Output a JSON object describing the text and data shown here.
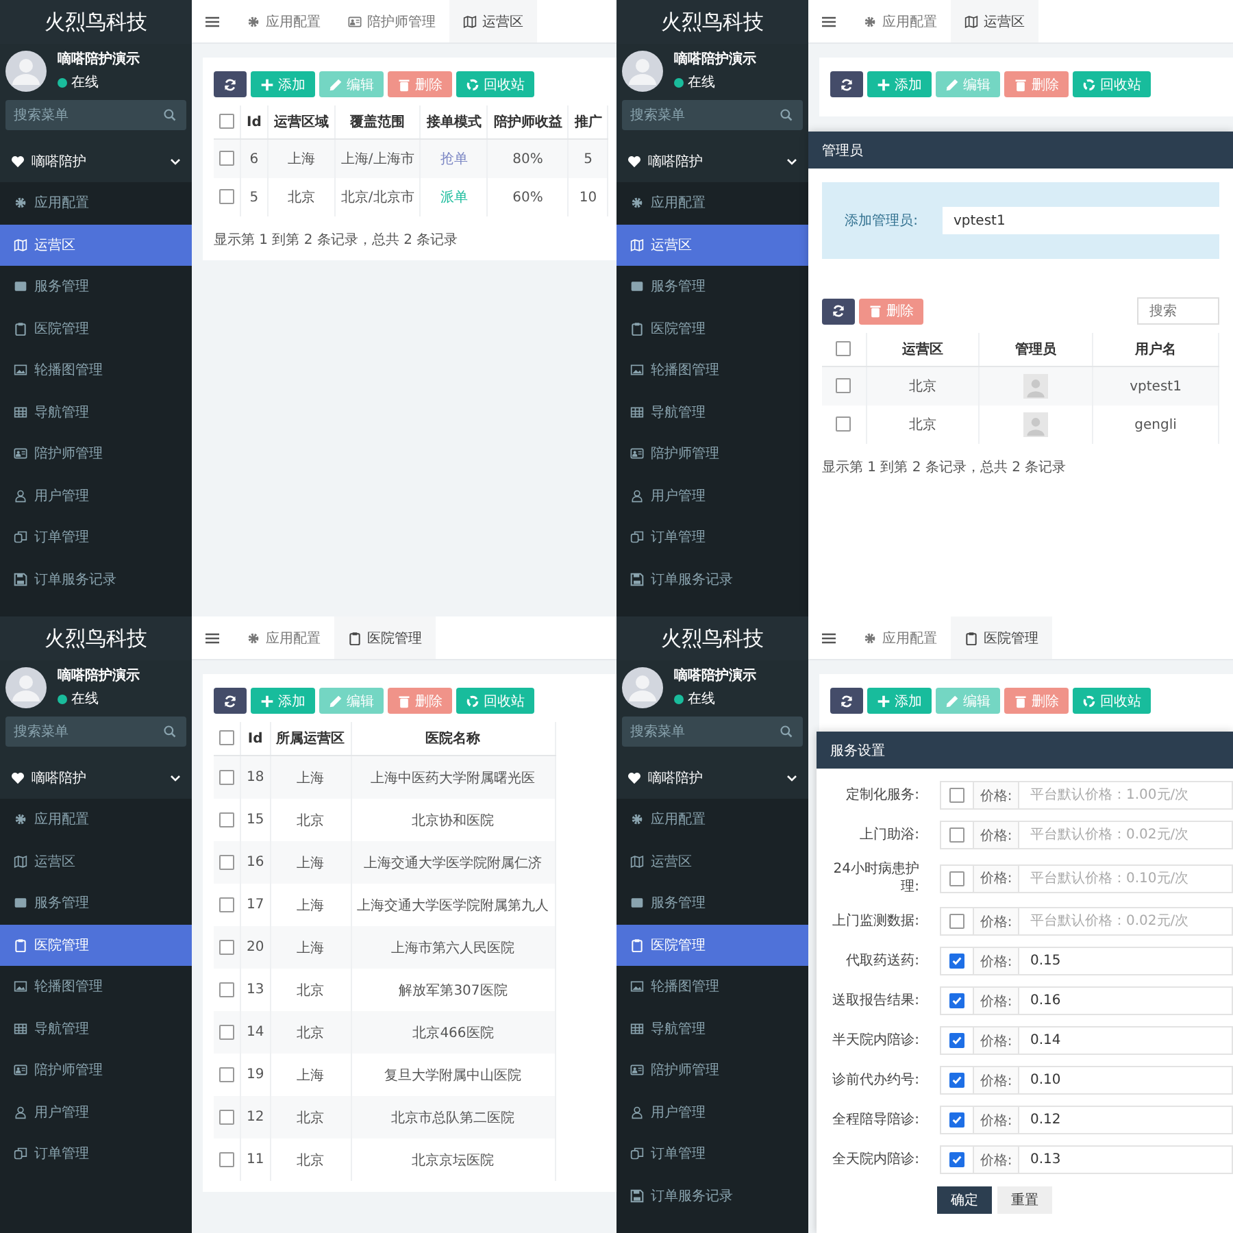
{
  "panels": [
    {
      "sidebar": {
        "brand": "火烈鸟科技",
        "user": {
          "name": "嘀嗒陪护演示",
          "status": "在线"
        },
        "search": {
          "placeholder": "搜索菜单"
        },
        "group": {
          "label": "嘀嗒陪护",
          "expanded": true
        },
        "items": [
          {
            "kind": "settings",
            "label": "应用配置",
            "selected": false
          },
          {
            "kind": "map",
            "label": "运营区",
            "selected": true
          },
          {
            "kind": "window",
            "label": "服务管理",
            "selected": false
          },
          {
            "kind": "clipboard",
            "label": "医院管理",
            "selected": false
          },
          {
            "kind": "image",
            "label": "轮播图管理",
            "selected": false
          },
          {
            "kind": "grid",
            "label": "导航管理",
            "selected": false
          },
          {
            "kind": "idcard",
            "label": "陪护师管理",
            "selected": false
          },
          {
            "kind": "user",
            "label": "用户管理",
            "selected": false
          },
          {
            "kind": "copy",
            "label": "订单管理",
            "selected": false
          },
          {
            "kind": "save",
            "label": "订单服务记录",
            "selected": false
          }
        ]
      },
      "tabs": [
        {
          "kind": "settings",
          "label": "应用配置",
          "selected": false
        },
        {
          "kind": "idcard",
          "label": "陪护师管理",
          "selected": false
        },
        {
          "kind": "map",
          "label": "运营区",
          "selected": true
        }
      ],
      "content": {
        "kind": "table",
        "toolbar": [
          {
            "kind": "refresh",
            "disabled": false
          },
          {
            "kind": "add",
            "label": "添加",
            "disabled": false
          },
          {
            "kind": "edit",
            "label": "编辑",
            "disabled": true
          },
          {
            "kind": "delete",
            "label": "删除",
            "disabled": true
          },
          {
            "kind": "recycle",
            "label": "回收站",
            "disabled": false
          }
        ],
        "table": {
          "all_checked": false,
          "columns": [
            "Id",
            "运营区域",
            "覆盖范围",
            "接单模式",
            "陪护师收益",
            "推广"
          ],
          "rows": [
            {
              "checked": false,
              "cells": [
                "6",
                "上海",
                "上海/上海市",
                {
                  "text": "抢单",
                  "color": "#7b86c4"
                },
                "80%",
                "5"
              ]
            },
            {
              "checked": false,
              "cells": [
                "5",
                "北京",
                "北京/北京市",
                {
                  "text": "派单",
                  "color": "#1abc9c"
                },
                "60%",
                "10"
              ]
            }
          ]
        },
        "footer": "显示第 1 到第 2 条记录，总共 2 条记录"
      }
    },
    {
      "sidebar": {
        "brand": "火烈鸟科技",
        "user": {
          "name": "嘀嗒陪护演示",
          "status": "在线"
        },
        "search": {
          "placeholder": "搜索菜单"
        },
        "group": {
          "label": "嘀嗒陪护",
          "expanded": true
        },
        "items": [
          {
            "kind": "settings",
            "label": "应用配置",
            "selected": false
          },
          {
            "kind": "map",
            "label": "运营区",
            "selected": true
          },
          {
            "kind": "window",
            "label": "服务管理",
            "selected": false
          },
          {
            "kind": "clipboard",
            "label": "医院管理",
            "selected": false
          },
          {
            "kind": "image",
            "label": "轮播图管理",
            "selected": false
          },
          {
            "kind": "grid",
            "label": "导航管理",
            "selected": false
          },
          {
            "kind": "idcard",
            "label": "陪护师管理",
            "selected": false
          },
          {
            "kind": "user",
            "label": "用户管理",
            "selected": false
          },
          {
            "kind": "copy",
            "label": "订单管理",
            "selected": false
          },
          {
            "kind": "save",
            "label": "订单服务记录",
            "selected": false
          }
        ]
      },
      "tabs": [
        {
          "kind": "settings",
          "label": "应用配置",
          "selected": false
        },
        {
          "kind": "map",
          "label": "运营区",
          "selected": true
        }
      ],
      "content": {
        "kind": "admin_modal",
        "toolbar": [
          {
            "kind": "refresh",
            "disabled": false
          },
          {
            "kind": "add",
            "label": "添加",
            "disabled": false
          },
          {
            "kind": "edit",
            "label": "编辑",
            "disabled": true
          },
          {
            "kind": "delete",
            "label": "删除",
            "disabled": true
          },
          {
            "kind": "recycle",
            "label": "回收站",
            "disabled": false
          }
        ],
        "modal": {
          "title": "管理员",
          "form": {
            "label": "添加管理员:",
            "value": "vptest1"
          },
          "toolbar": [
            {
              "kind": "refresh",
              "disabled": false
            },
            {
              "kind": "delete",
              "label": "删除",
              "disabled": true
            }
          ],
          "search": {
            "placeholder": "搜索"
          },
          "table": {
            "all_checked": false,
            "columns": [
              "运营区",
              "管理员",
              "用户名"
            ],
            "rows": [
              {
                "checked": false,
                "region": "北京",
                "username": "vptest1"
              },
              {
                "checked": false,
                "region": "北京",
                "username": "gengli"
              }
            ]
          },
          "footer": "显示第 1 到第 2 条记录，总共 2 条记录"
        }
      }
    },
    {
      "sidebar": {
        "brand": "火烈鸟科技",
        "user": {
          "name": "嘀嗒陪护演示",
          "status": "在线"
        },
        "search": {
          "placeholder": "搜索菜单"
        },
        "group": {
          "label": "嘀嗒陪护",
          "expanded": true
        },
        "items": [
          {
            "kind": "settings",
            "label": "应用配置",
            "selected": false
          },
          {
            "kind": "map",
            "label": "运营区",
            "selected": false
          },
          {
            "kind": "window",
            "label": "服务管理",
            "selected": false
          },
          {
            "kind": "clipboard",
            "label": "医院管理",
            "selected": true
          },
          {
            "kind": "image",
            "label": "轮播图管理",
            "selected": false
          },
          {
            "kind": "grid",
            "label": "导航管理",
            "selected": false
          },
          {
            "kind": "idcard",
            "label": "陪护师管理",
            "selected": false
          },
          {
            "kind": "user",
            "label": "用户管理",
            "selected": false
          },
          {
            "kind": "copy",
            "label": "订单管理",
            "selected": false
          }
        ]
      },
      "tabs": [
        {
          "kind": "settings",
          "label": "应用配置",
          "selected": false
        },
        {
          "kind": "clipboard",
          "label": "医院管理",
          "selected": true
        }
      ],
      "content": {
        "kind": "table",
        "toolbar": [
          {
            "kind": "refresh",
            "disabled": false
          },
          {
            "kind": "add",
            "label": "添加",
            "disabled": false
          },
          {
            "kind": "edit",
            "label": "编辑",
            "disabled": true
          },
          {
            "kind": "delete",
            "label": "删除",
            "disabled": true
          },
          {
            "kind": "recycle",
            "label": "回收站",
            "disabled": false
          }
        ],
        "table": {
          "all_checked": false,
          "columns": [
            "Id",
            "所属运营区",
            "医院名称"
          ],
          "rows": [
            {
              "checked": false,
              "cells": [
                "18",
                "上海",
                "上海中医药大学附属曙光医"
              ]
            },
            {
              "checked": false,
              "cells": [
                "15",
                "北京",
                "北京协和医院"
              ]
            },
            {
              "checked": false,
              "cells": [
                "16",
                "上海",
                "上海交通大学医学院附属仁济"
              ]
            },
            {
              "checked": false,
              "cells": [
                "17",
                "上海",
                "上海交通大学医学院附属第九人"
              ]
            },
            {
              "checked": false,
              "cells": [
                "20",
                "上海",
                "上海市第六人民医院"
              ]
            },
            {
              "checked": false,
              "cells": [
                "13",
                "北京",
                "解放军第307医院"
              ]
            },
            {
              "checked": false,
              "cells": [
                "14",
                "北京",
                "北京466医院"
              ]
            },
            {
              "checked": false,
              "cells": [
                "19",
                "上海",
                "复旦大学附属中山医院"
              ]
            },
            {
              "checked": false,
              "cells": [
                "12",
                "北京",
                "北京市总队第二医院"
              ]
            },
            {
              "checked": false,
              "cells": [
                "11",
                "北京",
                "北京京坛医院"
              ]
            }
          ]
        }
      }
    },
    {
      "sidebar": {
        "brand": "火烈鸟科技",
        "user": {
          "name": "嘀嗒陪护演示",
          "status": "在线"
        },
        "search": {
          "placeholder": "搜索菜单"
        },
        "group": {
          "label": "嘀嗒陪护",
          "expanded": true
        },
        "items": [
          {
            "kind": "settings",
            "label": "应用配置",
            "selected": false
          },
          {
            "kind": "map",
            "label": "运营区",
            "selected": false
          },
          {
            "kind": "window",
            "label": "服务管理",
            "selected": false
          },
          {
            "kind": "clipboard",
            "label": "医院管理",
            "selected": true
          },
          {
            "kind": "image",
            "label": "轮播图管理",
            "selected": false
          },
          {
            "kind": "grid",
            "label": "导航管理",
            "selected": false
          },
          {
            "kind": "idcard",
            "label": "陪护师管理",
            "selected": false
          },
          {
            "kind": "user",
            "label": "用户管理",
            "selected": false
          },
          {
            "kind": "copy",
            "label": "订单管理",
            "selected": false
          },
          {
            "kind": "save",
            "label": "订单服务记录",
            "selected": false
          }
        ]
      },
      "tabs": [
        {
          "kind": "settings",
          "label": "应用配置",
          "selected": false
        },
        {
          "kind": "clipboard",
          "label": "医院管理",
          "selected": true
        }
      ],
      "content": {
        "kind": "service_modal",
        "toolbar": [
          {
            "kind": "refresh",
            "disabled": false
          },
          {
            "kind": "add",
            "label": "添加",
            "disabled": false
          },
          {
            "kind": "edit",
            "label": "编辑",
            "disabled": true
          },
          {
            "kind": "delete",
            "label": "删除",
            "disabled": true
          },
          {
            "kind": "recycle",
            "label": "回收站",
            "disabled": false
          }
        ],
        "modal": {
          "title": "服务设置",
          "rows": [
            {
              "label": "定制化服务:",
              "checked": false,
              "price_label": "价格:",
              "placeholder": "平台默认价格：1.00元/次"
            },
            {
              "label": "上门助浴:",
              "checked": false,
              "price_label": "价格:",
              "placeholder": "平台默认价格：0.02元/次"
            },
            {
              "label": "24小时病患护理:",
              "checked": false,
              "price_label": "价格:",
              "placeholder": "平台默认价格：0.10元/次"
            },
            {
              "label": "上门监测数据:",
              "checked": false,
              "price_label": "价格:",
              "placeholder": "平台默认价格：0.02元/次"
            },
            {
              "label": "代取药送药:",
              "checked": true,
              "price_label": "价格:",
              "value": "0.15"
            },
            {
              "label": "送取报告结果:",
              "checked": true,
              "price_label": "价格:",
              "value": "0.16"
            },
            {
              "label": "半天院内陪诊:",
              "checked": true,
              "price_label": "价格:",
              "value": "0.14"
            },
            {
              "label": "诊前代办约号:",
              "checked": true,
              "price_label": "价格:",
              "value": "0.10"
            },
            {
              "label": "全程陪导陪诊:",
              "checked": true,
              "price_label": "价格:",
              "value": "0.12"
            },
            {
              "label": "全天院内陪诊:",
              "checked": true,
              "price_label": "价格:",
              "value": "0.13"
            }
          ],
          "buttons": [
            {
              "kind": "primary",
              "label": "确定"
            },
            {
              "kind": "default",
              "label": "重置"
            }
          ]
        }
      }
    }
  ]
}
